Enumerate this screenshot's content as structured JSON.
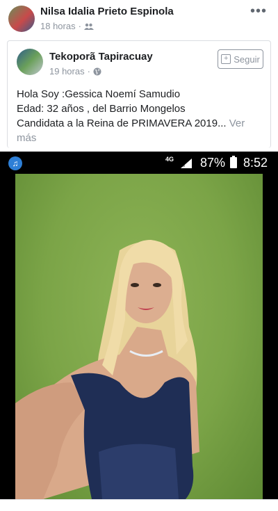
{
  "post": {
    "author": "Nilsa Idalia Prieto Espinola",
    "time": "18 horas",
    "privacy_icon": "friends-icon"
  },
  "shared": {
    "page_name": "Tekoporã Tapiracuay",
    "time": "19 horas",
    "privacy_icon": "globe-icon",
    "follow_label": "Seguir",
    "text_lines": [
      "Hola Soy :Gessica Noemí Samudio",
      "Edad: 32 años , del Barrio Mongelos",
      "Candidata a la Reina de PRIMAVERA 2019..."
    ],
    "see_more_1": "Ver",
    "see_more_2": "más"
  },
  "status_bar": {
    "network": "4G",
    "battery": "87%",
    "clock": "8:52"
  },
  "colors": {
    "accent": "#2e7fd6",
    "photo_background": "#7ba447"
  }
}
